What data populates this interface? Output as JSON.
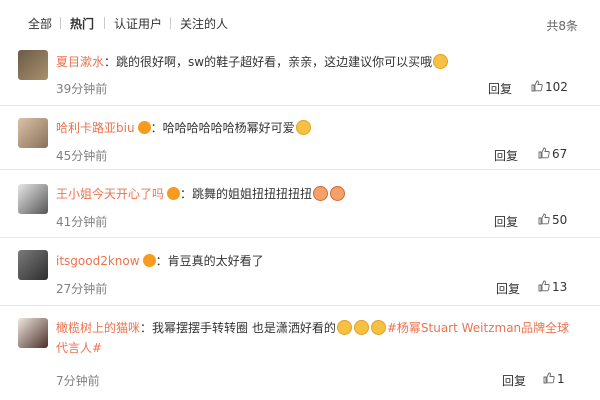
{
  "filters": {
    "all": "全部",
    "hot": "热门",
    "verified": "认证用户",
    "following": "关注的人",
    "total": "共8条"
  },
  "comments": [
    {
      "username": "夏目漱水",
      "text": "：跳的很好啊，sw的鞋子超好看，亲亲，这边建议你可以买哦",
      "time": "39分钟前",
      "reply": "回复",
      "likes": "102"
    },
    {
      "username": "哈利卡路亚biu",
      "text": "：哈哈哈哈哈哈杨幂好可爱",
      "time": "45分钟前",
      "reply": "回复",
      "likes": "67"
    },
    {
      "username": "王小姐今天开心了吗",
      "text": "：跳舞的姐姐扭扭扭扭扭",
      "time": "41分钟前",
      "reply": "回复",
      "likes": "50"
    },
    {
      "username": "itsgood2know",
      "text": "：肯豆真的太好看了",
      "time": "27分钟前",
      "reply": "回复",
      "likes": "13"
    },
    {
      "username": "橄榄树上的猫咪",
      "text": "：我幂摆摆手转转圈 也是潇洒好看的",
      "hashtag": "#杨幂Stuart Weitzman品牌全球代言人#",
      "time": "7分钟前",
      "reply": "回复",
      "likes": "1"
    }
  ],
  "colors": {
    "username": "#eb7350",
    "text": "#333333",
    "time": "#808080",
    "divider": "#e8e8e8"
  },
  "icons": {
    "like": "thumbs-up-icon",
    "vip": "vip-badge-icon",
    "emoji": "emoji-icon"
  }
}
